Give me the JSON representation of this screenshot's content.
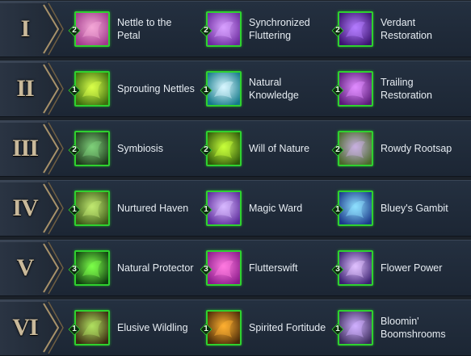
{
  "tiers": [
    {
      "numeral": "I",
      "talents": [
        {
          "name": "Nettle to the Petal",
          "rank": "2",
          "icon": "nettle-petal-icon",
          "c1": "#f4a7d6",
          "c2": "#a03a8c"
        },
        {
          "name": "Synchronized Fluttering",
          "rank": "2",
          "icon": "synchronized-fluttering-icon",
          "c1": "#d8a0ff",
          "c2": "#6b2a9e"
        },
        {
          "name": "Verdant Restoration",
          "rank": "2",
          "icon": "verdant-restoration-icon",
          "c1": "#b47cff",
          "c2": "#3b1370"
        }
      ]
    },
    {
      "numeral": "II",
      "talents": [
        {
          "name": "Sprouting Nettles",
          "rank": "1",
          "icon": "sprouting-nettles-icon",
          "c1": "#d9ff4a",
          "c2": "#3c6e0e"
        },
        {
          "name": "Natural Knowledge",
          "rank": "1",
          "icon": "natural-knowledge-icon",
          "c1": "#d8f6ff",
          "c2": "#147a8a"
        },
        {
          "name": "Trailing Restoration",
          "rank": "1",
          "icon": "trailing-restoration-icon",
          "c1": "#e08cff",
          "c2": "#5a1a78"
        }
      ]
    },
    {
      "numeral": "III",
      "talents": [
        {
          "name": "Symbiosis",
          "rank": "2",
          "icon": "symbiosis-icon",
          "c1": "#7fd07a",
          "c2": "#1e3a1c"
        },
        {
          "name": "Will of Nature",
          "rank": "2",
          "icon": "will-of-nature-icon",
          "c1": "#c8ff3a",
          "c2": "#2f5a0a"
        },
        {
          "name": "Rowdy Rootsap",
          "rank": "2",
          "icon": "rowdy-rootsap-icon",
          "c1": "#c8b0e0",
          "c2": "#4a6a2a"
        }
      ]
    },
    {
      "numeral": "IV",
      "talents": [
        {
          "name": "Nurtured Haven",
          "rank": "1",
          "icon": "nurtured-haven-icon",
          "c1": "#c0e870",
          "c2": "#3c5a18"
        },
        {
          "name": "Magic Ward",
          "rank": "1",
          "icon": "magic-ward-icon",
          "c1": "#d8b8ff",
          "c2": "#5b2a9a"
        },
        {
          "name": "Bluey's Gambit",
          "rank": "1",
          "icon": "blueys-gambit-icon",
          "c1": "#8ee0ff",
          "c2": "#1a3a8a"
        }
      ]
    },
    {
      "numeral": "V",
      "talents": [
        {
          "name": "Natural Protector",
          "rank": "3",
          "icon": "natural-protector-icon",
          "c1": "#7dff4a",
          "c2": "#104010"
        },
        {
          "name": "Flutterswift",
          "rank": "3",
          "icon": "flutterswift-icon",
          "c1": "#ff7ae0",
          "c2": "#8a1a8a"
        },
        {
          "name": "Flower Power",
          "rank": "3",
          "icon": "flower-power-icon",
          "c1": "#e0c0ff",
          "c2": "#3a2070"
        }
      ]
    },
    {
      "numeral": "VI",
      "talents": [
        {
          "name": "Elusive Wildling",
          "rank": "1",
          "icon": "elusive-wildling-icon",
          "c1": "#b0e060",
          "c2": "#3a2a10"
        },
        {
          "name": "Spirited Fortitude",
          "rank": "1",
          "icon": "spirited-fortitude-icon",
          "c1": "#ffb030",
          "c2": "#4a2a08"
        },
        {
          "name": "Bloomin' Boomshrooms",
          "rank": "1",
          "icon": "bloomin-boomshrooms-icon",
          "c1": "#d0b0ff",
          "c2": "#3a2a5a"
        }
      ]
    }
  ],
  "colors": {
    "background": "#1b2129",
    "selected_border": "#2fd12f",
    "tier_numeral": "#c9b99a",
    "label_text": "#e6ecf2"
  }
}
